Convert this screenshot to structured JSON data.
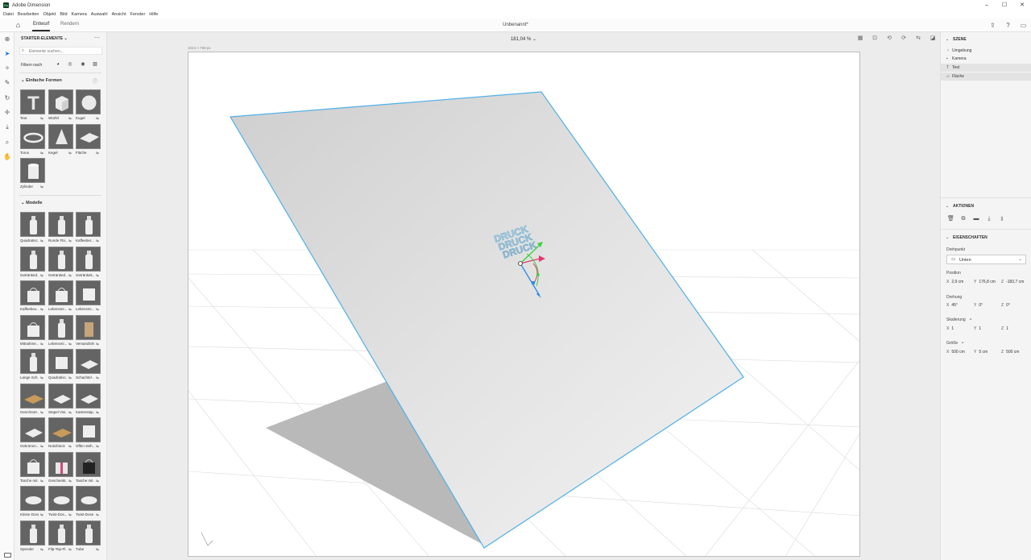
{
  "window": {
    "title": "Adobe Dimension",
    "icon_text": "Dn",
    "minimize": "–",
    "maximize": "☐",
    "close": "✕"
  },
  "menu": [
    "Datei",
    "Bearbeiten",
    "Objekt",
    "Bild",
    "Kamera",
    "Auswahl",
    "Ansicht",
    "Fenster",
    "Hilfe"
  ],
  "toolbar": {
    "tabs": [
      "Entwurf",
      "Rendern"
    ],
    "doc_title": "Unbenannt*"
  },
  "view": {
    "zoom": "181,04 %",
    "canvas_size": "1024 × 768 px",
    "text_on_object": "DRUCK"
  },
  "assets": {
    "header": "STARTER-ELEMENTE",
    "search_placeholder": "Elemente suchen...",
    "filter_label": "Filtern nach",
    "sections": {
      "basic": "Einfache Formen",
      "models": "Modelle"
    },
    "basic_shapes": [
      "Text",
      "Würfel",
      "Kugel",
      "Torus",
      "Kegel",
      "Fläche",
      "Zylinder"
    ],
    "models": [
      "Quadratisc...",
      "Runde Fla...",
      "Kaffeeber...",
      "Getränked...",
      "Getränked...",
      "Getränkek...",
      "Kaffeebeu...",
      "Lebensmi...",
      "Lebensmi...",
      "Mitnahme...",
      "Lebensmi...",
      "Versandröhr",
      "Lange Sch...",
      "Quadratisc...",
      "Schachtel ...",
      "Geschnürt...",
      "Stapel Visi...",
      "Kartenstap...",
      "Gekrümm...",
      "Notizblock",
      "Offen steh...",
      "Tasche mit...",
      "Geschenkt...",
      "Tasche mit...",
      "Kleine Dose",
      "Twist-Dos...",
      "Twist-Dose",
      "Spender",
      "Flip-Top-Fl...",
      "Tube"
    ]
  },
  "scene": {
    "header": "SZENE",
    "items": [
      "Umgebung",
      "Kamera",
      "Text",
      "Fläche"
    ]
  },
  "actions": {
    "header": "AKTIONEN"
  },
  "properties": {
    "header": "EIGENSCHAFTEN",
    "pivot_label": "Drehpunkt",
    "pivot_value": "Unten",
    "position_label": "Position",
    "position": {
      "x": "2,9 cm",
      "y": "176,8 cm",
      "z": "-183,7 cm"
    },
    "rotation_label": "Drehung",
    "rotation": {
      "x": "45°",
      "y": "0°",
      "z": "0°"
    },
    "scale_label": "Skalierung",
    "scale": {
      "x": "1",
      "y": "1",
      "z": "1"
    },
    "size_label": "Größe",
    "size": {
      "x": "500 cm",
      "y": "5 cm",
      "z": "500 cm"
    },
    "axis": {
      "x": "X",
      "y": "Y",
      "z": "Z"
    }
  },
  "colors": {
    "selection": "#4fb0e6",
    "accent": "#1473e6",
    "gizmo_green": "#3bd13b",
    "gizmo_red": "#e03a6e",
    "gizmo_blue": "#2d8ce6"
  }
}
